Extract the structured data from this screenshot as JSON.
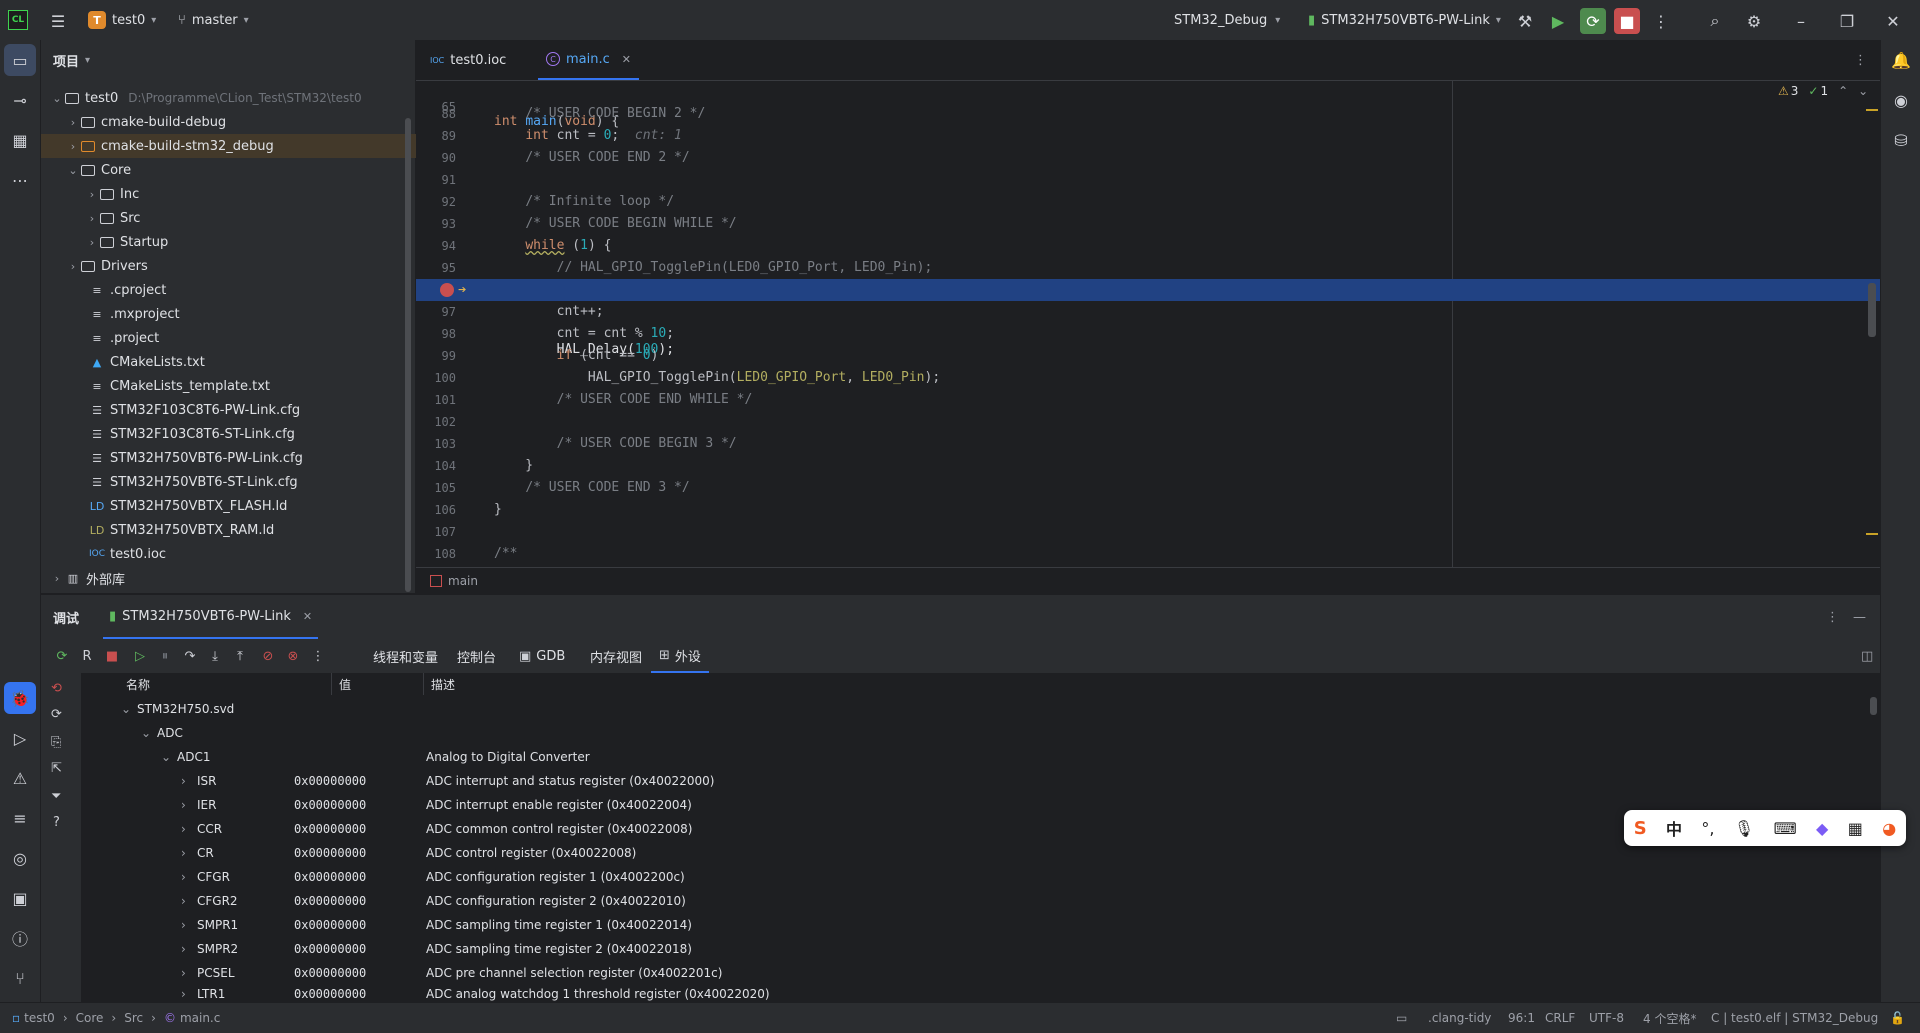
{
  "titlebar": {
    "project_letter": "T",
    "project_name": "test0",
    "branch": "master",
    "config": "STM32_Debug",
    "run_target": "STM32H750VBT6-PW-Link"
  },
  "project": {
    "header": "项目",
    "root": {
      "name": "test0",
      "path": "D:\\Programme\\CLion_Test\\STM32\\test0"
    },
    "items": [
      {
        "label": "cmake-build-debug"
      },
      {
        "label": "cmake-build-stm32_debug"
      },
      {
        "label": "Core"
      },
      {
        "label": "Inc"
      },
      {
        "label": "Src"
      },
      {
        "label": "Startup"
      },
      {
        "label": "Drivers"
      },
      {
        "label": ".cproject"
      },
      {
        "label": ".mxproject"
      },
      {
        "label": ".project"
      },
      {
        "label": "CMakeLists.txt"
      },
      {
        "label": "CMakeLists_template.txt"
      },
      {
        "label": "STM32F103C8T6-PW-Link.cfg"
      },
      {
        "label": "STM32F103C8T6-ST-Link.cfg"
      },
      {
        "label": "STM32H750VBT6-PW-Link.cfg"
      },
      {
        "label": "STM32H750VBT6-ST-Link.cfg"
      },
      {
        "label": "STM32H750VBTX_FLASH.ld"
      },
      {
        "label": "STM32H750VBTX_RAM.ld"
      },
      {
        "label": "test0.ioc"
      },
      {
        "label": "外部库"
      }
    ]
  },
  "editor": {
    "tabs": [
      {
        "label": "test0.ioc",
        "icon": "IOC"
      },
      {
        "label": "main.c",
        "icon": "C"
      }
    ],
    "sticky_line": {
      "num": "65"
    },
    "inspections": {
      "warnings": "3",
      "checks": "1"
    },
    "line_numbers": [
      "88",
      "89",
      "90",
      "91",
      "92",
      "93",
      "94",
      "95",
      "96",
      "97",
      "98",
      "99",
      "100",
      "101",
      "102",
      "103",
      "104",
      "105",
      "106",
      "107",
      "108"
    ],
    "breadcrumb": "main"
  },
  "debug": {
    "title": "调试",
    "session": "STM32H750VBT6-PW-Link",
    "tabs": [
      "线程和变量",
      "控制台",
      "GDB",
      "内存视图",
      "外设"
    ],
    "columns": {
      "name": "名称",
      "value": "值",
      "desc": "描述"
    },
    "tree": [
      {
        "name": "STM32H750.svd",
        "value": "",
        "desc": ""
      },
      {
        "name": "ADC",
        "value": "",
        "desc": ""
      },
      {
        "name": "ADC1",
        "value": "",
        "desc": "Analog to Digital Converter"
      },
      {
        "name": "ISR",
        "value": "0x00000000",
        "desc": "ADC interrupt and status register (0x40022000)"
      },
      {
        "name": "IER",
        "value": "0x00000000",
        "desc": "ADC interrupt enable register (0x40022004)"
      },
      {
        "name": "CCR",
        "value": "0x00000000",
        "desc": "ADC common control register (0x40022008)"
      },
      {
        "name": "CR",
        "value": "0x00000000",
        "desc": "ADC control register (0x40022008)"
      },
      {
        "name": "CFGR",
        "value": "0x00000000",
        "desc": "ADC configuration register 1 (0x4002200c)"
      },
      {
        "name": "CFGR2",
        "value": "0x00000000",
        "desc": "ADC configuration register 2 (0x40022010)"
      },
      {
        "name": "SMPR1",
        "value": "0x00000000",
        "desc": "ADC sampling time register 1 (0x40022014)"
      },
      {
        "name": "SMPR2",
        "value": "0x00000000",
        "desc": "ADC sampling time register 2 (0x40022018)"
      },
      {
        "name": "PCSEL",
        "value": "0x00000000",
        "desc": "ADC pre channel selection register (0x4002201c)"
      },
      {
        "name": "LTR1",
        "value": "0x00000000",
        "desc": "ADC analog watchdog 1 threshold register (0x40022020)"
      }
    ]
  },
  "statusbar": {
    "crumbs": [
      "test0",
      "Core",
      "Src",
      "main.c"
    ],
    "linter": ".clang-tidy",
    "position": "96:1",
    "line_sep": "CRLF",
    "encoding": "UTF-8",
    "indent": "4 个空格*",
    "context": "C | test0.elf | STM32_Debug"
  },
  "ime": {
    "mode": "中"
  }
}
